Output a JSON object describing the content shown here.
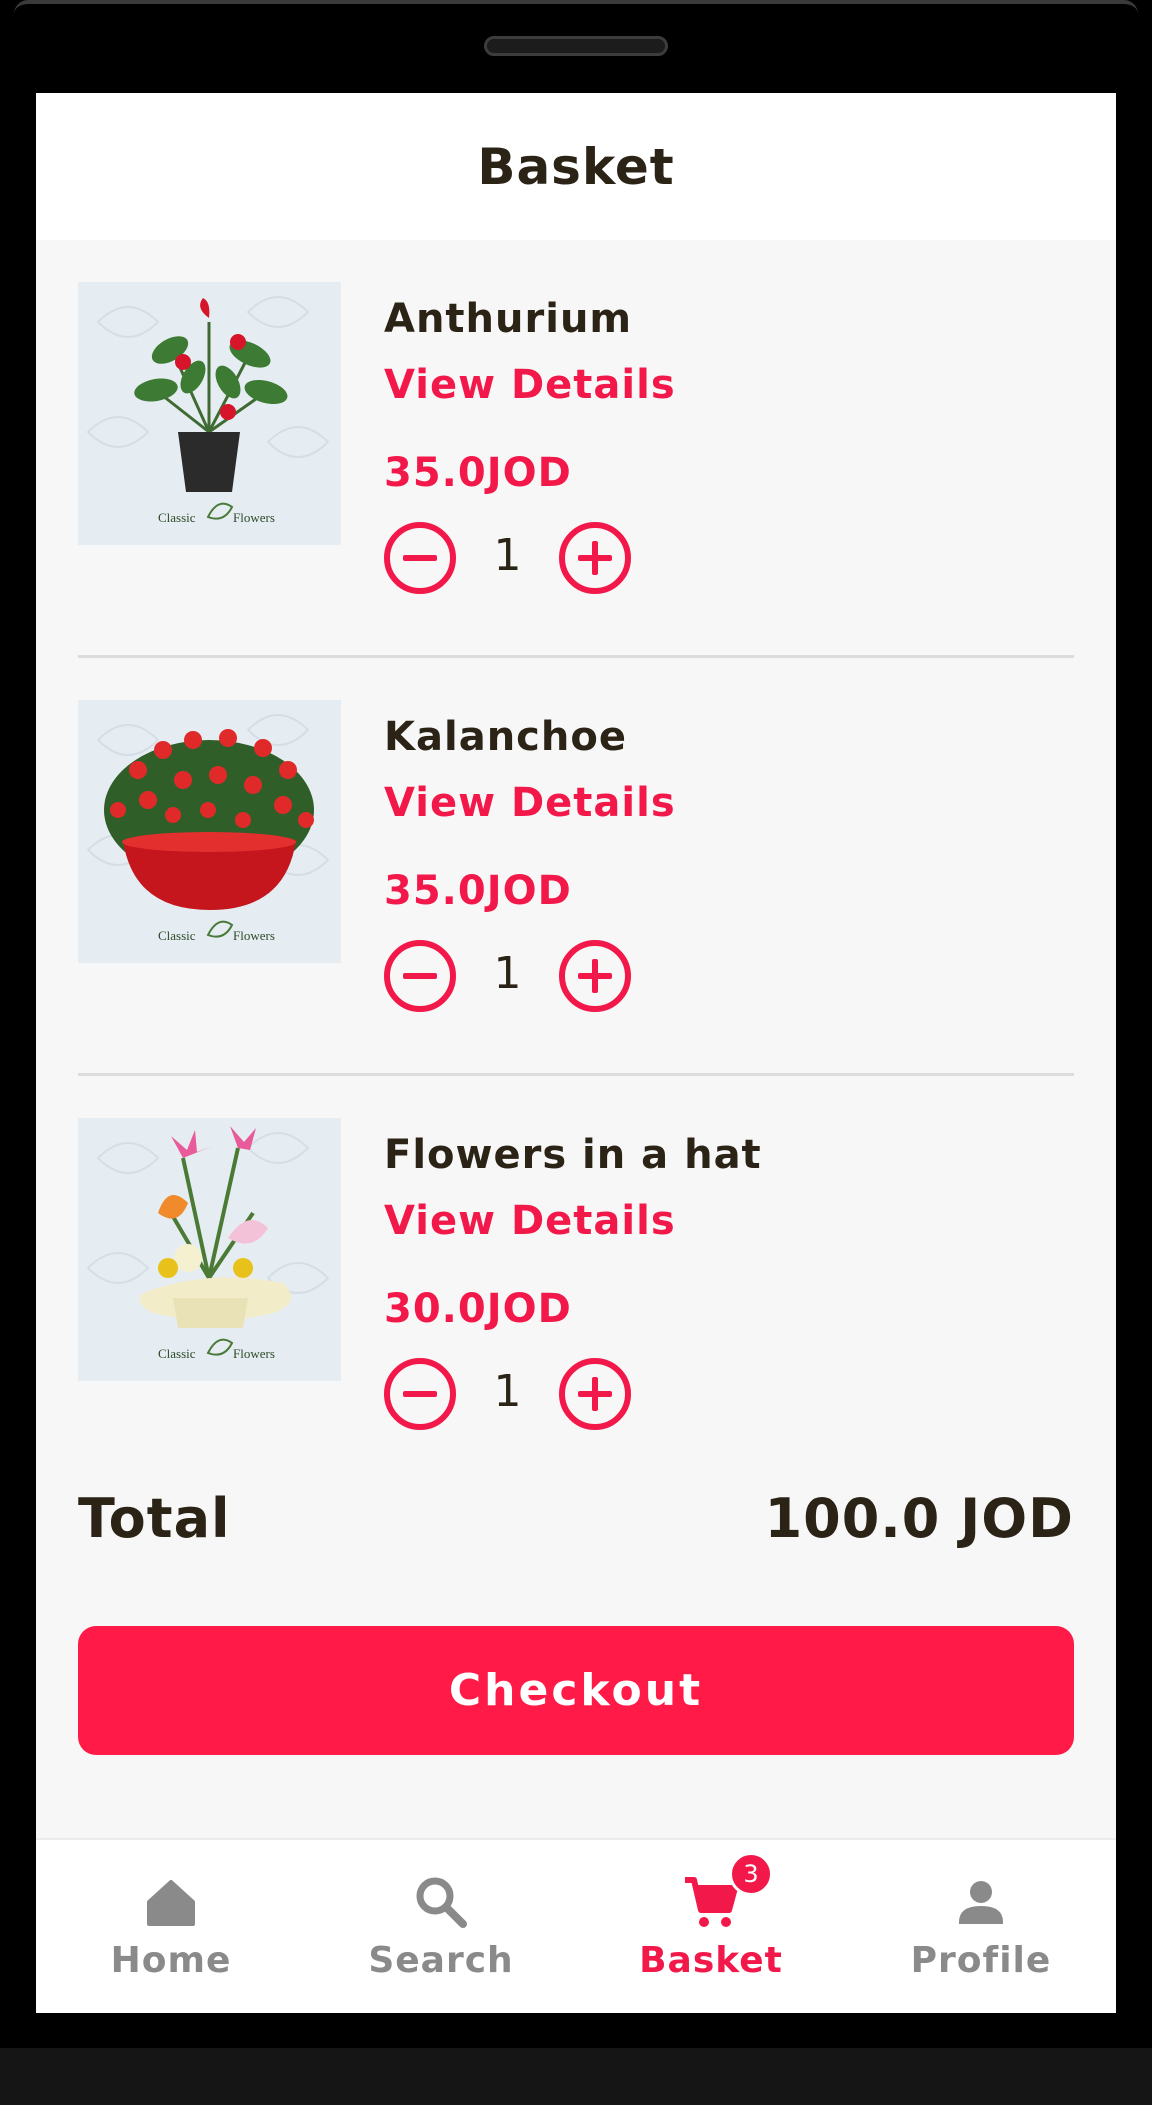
{
  "header": {
    "title": "Basket"
  },
  "basket": {
    "items": [
      {
        "name": "Anthurium",
        "details_link": "View Details",
        "price": "35.0JOD",
        "quantity": "1",
        "image_caption_left": "Classic",
        "image_caption_right": "Flowers"
      },
      {
        "name": "Kalanchoe",
        "details_link": "View Details",
        "price": "35.0JOD",
        "quantity": "1",
        "image_caption_left": "Classic",
        "image_caption_right": "Flowers"
      },
      {
        "name": "Flowers in a hat",
        "details_link": "View Details",
        "price": "30.0JOD",
        "quantity": "1",
        "image_caption_left": "Classic",
        "image_caption_right": "Flowers"
      }
    ],
    "total_label": "Total",
    "total_value": "100.0 JOD",
    "checkout_label": "Checkout"
  },
  "nav": {
    "items": [
      {
        "label": "Home",
        "icon": "home-icon",
        "active": false
      },
      {
        "label": "Search",
        "icon": "search-icon",
        "active": false
      },
      {
        "label": "Basket",
        "icon": "cart-icon",
        "active": true,
        "badge": "3"
      },
      {
        "label": "Profile",
        "icon": "person-icon",
        "active": false
      }
    ]
  },
  "colors": {
    "accent": "#f2194a",
    "checkout_button": "#ff1a47",
    "text_dark": "#2b2416",
    "nav_inactive": "#8a8a8a",
    "screen_background": "#f7f7f7"
  }
}
